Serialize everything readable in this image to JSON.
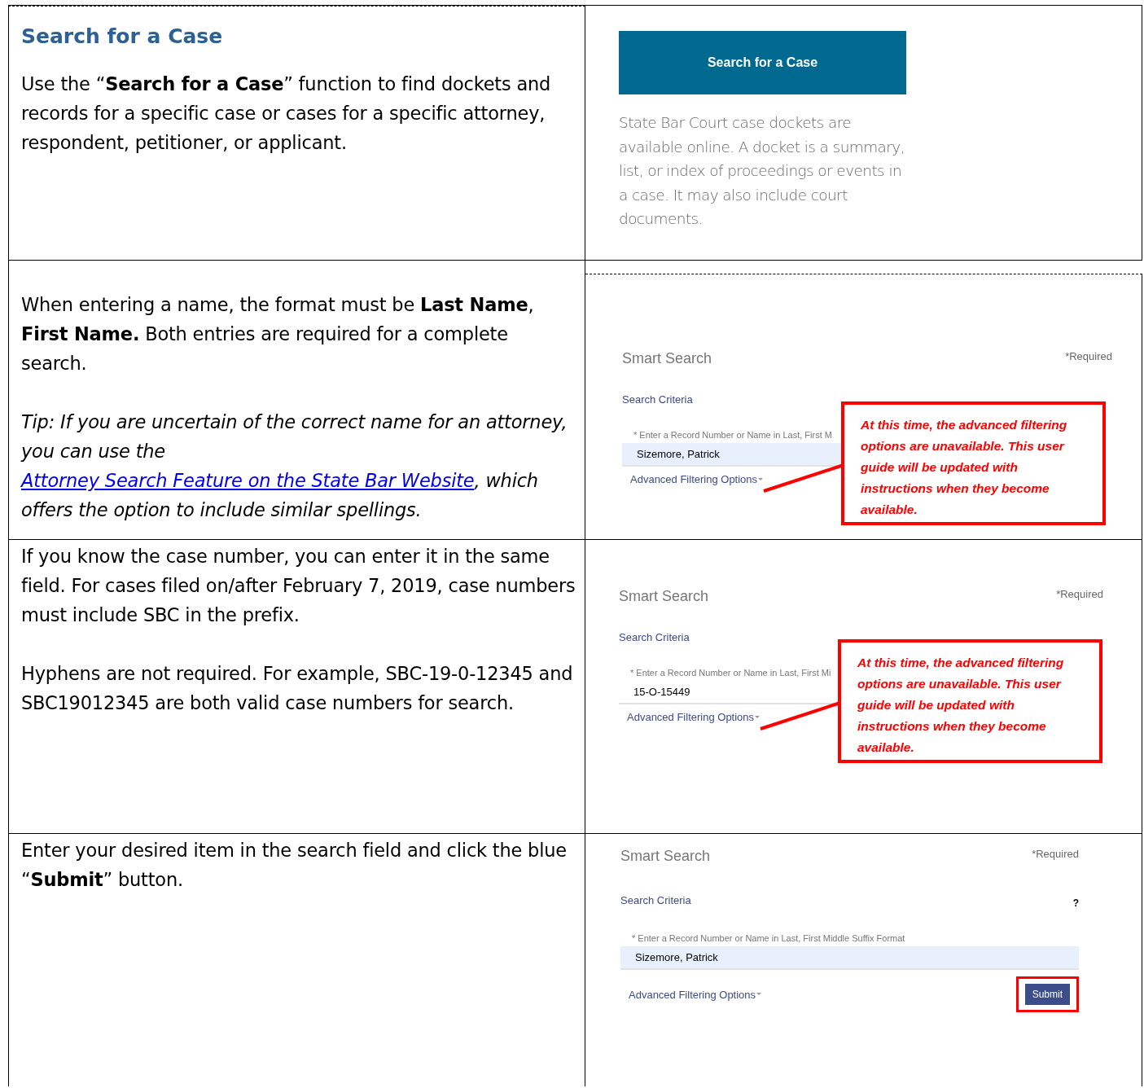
{
  "rows": [
    {
      "left": [
        {
          "kind": "heading",
          "text": "Search for a Case"
        },
        {
          "kind": "para",
          "text": "Use the “**Search for a Case**” function to find dockets and records for a specific case or cases for a specific attorney, respondent, petitioner, or applicant."
        }
      ],
      "right": {
        "kind": "promo",
        "button": "Search for a Case",
        "description": "State Bar Court case dockets are available online. A docket is a summary, list, or index of proceedings or events in a case. It may also include court documents."
      }
    },
    {
      "left": [
        {
          "kind": "para",
          "text": "When entering a name, the format must be **Last Name**, **First Name.** Both entries are required for a complete search."
        },
        {
          "kind": "tip",
          "before": "Tip: If you are uncertain of the correct name for an attorney, you can use the ",
          "link": "Attorney Search Feature on the State Bar Website",
          "after": ", which offers the option to include similar spellings."
        }
      ],
      "right": {
        "kind": "smart_search",
        "title": "Smart Search",
        "required": "*Required",
        "criteria": "Search Criteria",
        "field_label": "* Enter a Record Number or Name in Last, First M",
        "value": "Sizemore, Patrick",
        "autofilled": true,
        "advanced": "Advanced Filtering Options",
        "callout": "At this time, the advanced filtering options are unavailable. This user guide will be updated with instructions when they become available."
      }
    },
    {
      "left": [
        {
          "kind": "para",
          "text": "If you know the case number, you can enter it in the same field. For cases filed on/after February 7, 2019, case numbers must include SBC in the prefix."
        },
        {
          "kind": "para",
          "text": "Hyphens are not required. For example, SBC-19-0-12345 and SBC19012345 are both valid case numbers for search."
        }
      ],
      "right": {
        "kind": "smart_search",
        "title": "Smart Search",
        "required": "*Required",
        "criteria": "Search Criteria",
        "field_label": "* Enter a Record Number or Name in Last, First Mi",
        "value": "15-O-15449",
        "autofilled": false,
        "advanced": "Advanced Filtering Options",
        "callout": "At this time, the advanced filtering options are unavailable. This user guide will be updated with instructions when they become available."
      }
    },
    {
      "left": [
        {
          "kind": "para",
          "text": "Enter your desired item in the search field and click the blue “**Submit**” button."
        }
      ],
      "right": {
        "kind": "smart_search",
        "title": "Smart Search",
        "required": "*Required",
        "criteria": "Search Criteria",
        "help": "?",
        "field_label": "* Enter a Record Number or Name in Last, First Middle Suffix Format",
        "value": "Sizemore, Patrick",
        "autofilled": true,
        "advanced": "Advanced Filtering Options",
        "submit": "Submit"
      }
    }
  ]
}
